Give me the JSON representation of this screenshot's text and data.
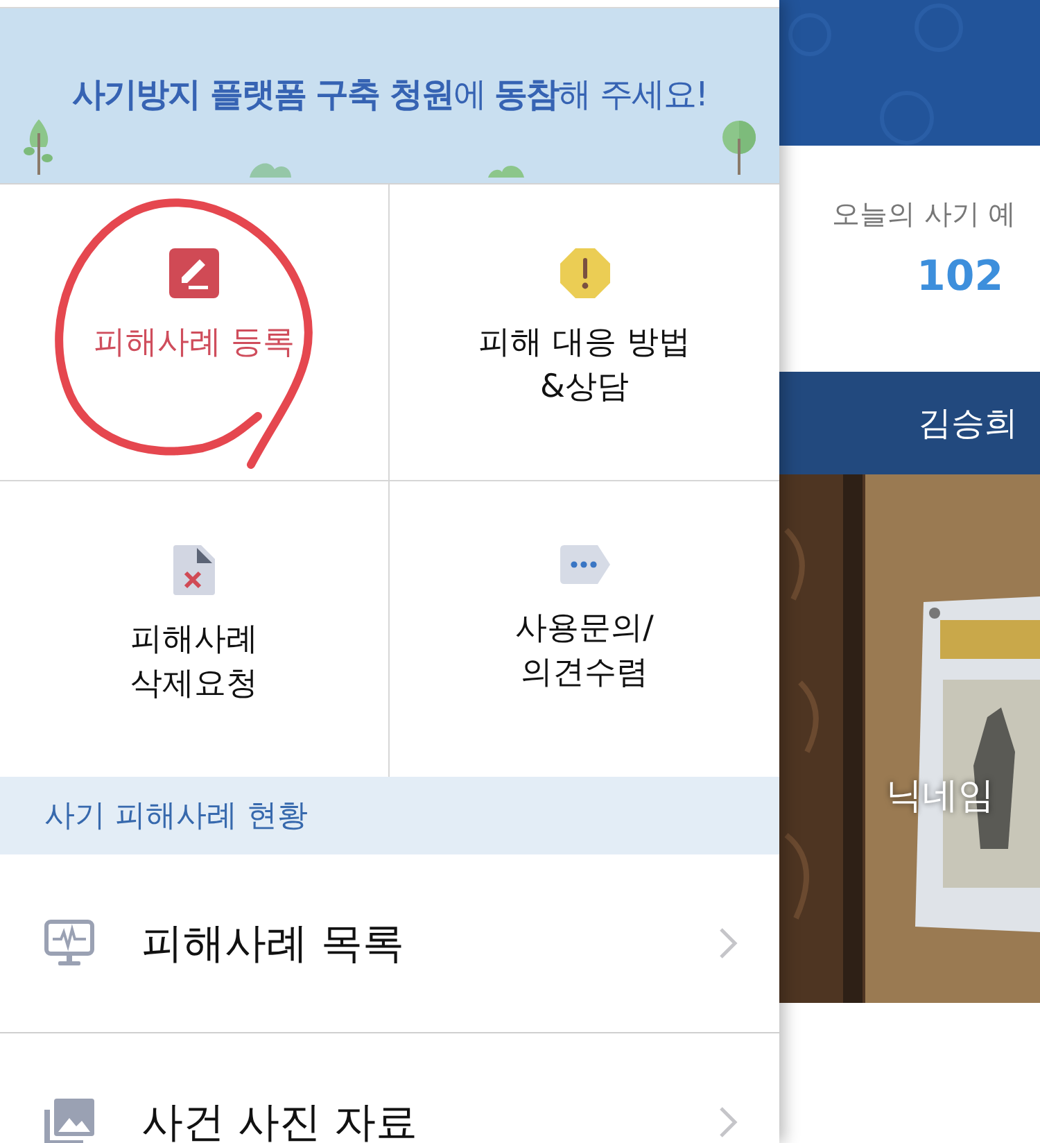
{
  "banner": {
    "text": "**사기방지 플랫폼 구축 청원**에 **동참**해 주세요!"
  },
  "tiles": [
    {
      "kind": "edit",
      "label": "피해사례 등록",
      "selected": true
    },
    {
      "kind": "warning",
      "label": "피해 대응 방법\n&상담",
      "selected": false
    },
    {
      "kind": "delete-doc",
      "label": "피해사례\n삭제요청",
      "selected": false
    },
    {
      "kind": "chat",
      "label": "사용문의/\n의견수렴",
      "selected": false
    }
  ],
  "section": {
    "title": "사기 피해사례 현황"
  },
  "menu": [
    {
      "kind": "monitor",
      "label": "피해사례 목록"
    },
    {
      "kind": "photos",
      "label": "사건 사진 자료"
    }
  ],
  "background_page": {
    "caption": "오늘의 사기 예",
    "count": "102",
    "banner": "김승희",
    "picture_caption": "닉네임"
  }
}
